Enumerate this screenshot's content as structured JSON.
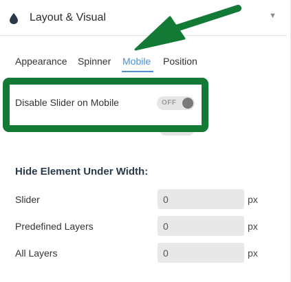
{
  "panel": {
    "title": "Layout & Visual",
    "title_icon": "drop-icon",
    "collapse_icon": "caret-down-icon",
    "caret_glyph": "▼"
  },
  "tabs": [
    {
      "label": "Appearance",
      "active": false
    },
    {
      "label": "Spinner",
      "active": false
    },
    {
      "label": "Mobile",
      "active": true
    },
    {
      "label": "Position",
      "active": false
    }
  ],
  "mobile_setting": {
    "label": "Disable Slider on Mobile",
    "toggle_text": "OFF",
    "state": "off"
  },
  "hide_section": {
    "title": "Hide Element Under Width:",
    "fields": [
      {
        "label": "Slider",
        "value": "0",
        "unit": "px"
      },
      {
        "label": "Predefined Layers",
        "value": "0",
        "unit": "px"
      },
      {
        "label": "All Layers",
        "value": "0",
        "unit": "px"
      }
    ]
  },
  "colors": {
    "accent": "#4a90d9",
    "annotation_green": "#137a36",
    "input_bg": "#e8e8e8"
  }
}
